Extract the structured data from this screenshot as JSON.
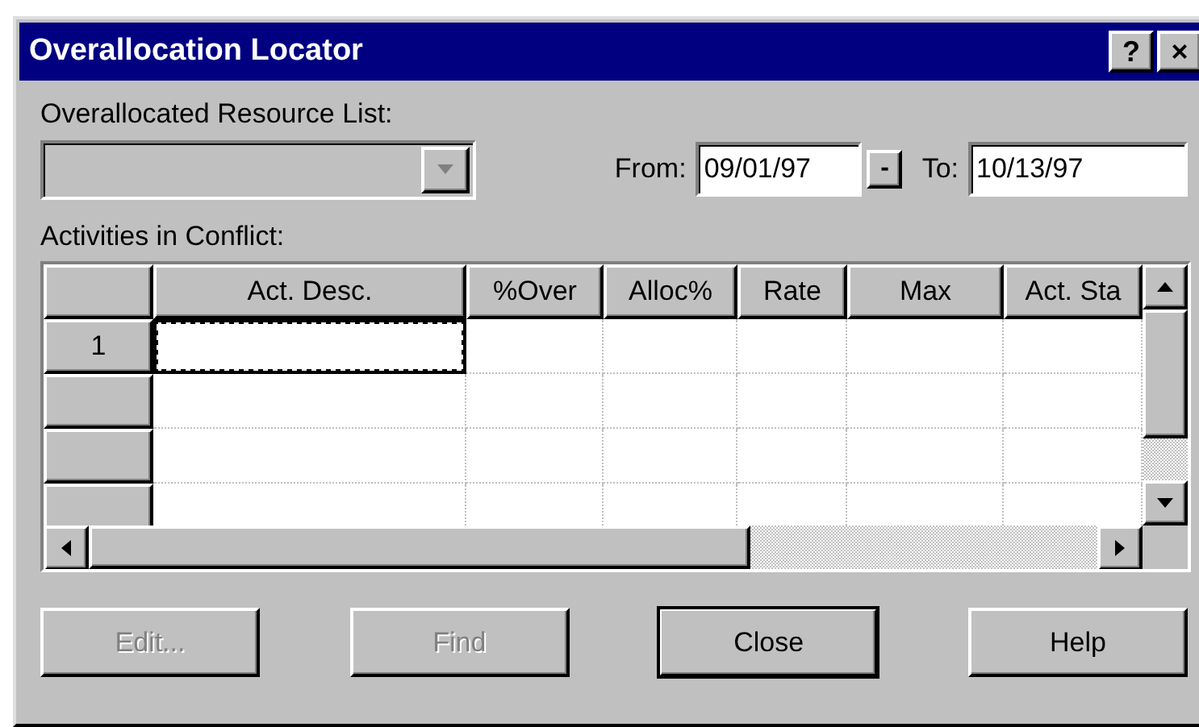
{
  "window": {
    "title": "Overallocation Locator",
    "title_buttons": [
      "?",
      "×"
    ]
  },
  "resource_list": {
    "label": "Overallocated Resource List:",
    "disabled": true
  },
  "date_range": {
    "from_label": "From:",
    "from_value": "09/01/97",
    "spin": "-",
    "to_label": "To:",
    "to_value": "10/13/97"
  },
  "grid": {
    "label": "Activities in Conflict:",
    "columns": [
      "Act. Desc.",
      "%Over",
      "Alloc%",
      "Rate",
      "Max",
      "Act. Sta"
    ],
    "rows": [
      {
        "number": "1",
        "selected": true
      },
      {
        "selected": false
      },
      {
        "selected": false
      },
      {
        "selected": false
      }
    ]
  },
  "buttons": [
    {
      "label": "Edit...",
      "disabled": true,
      "default": false
    },
    {
      "label": "Find",
      "disabled": true,
      "default": false
    },
    {
      "label": "Close",
      "disabled": false,
      "default": true
    },
    {
      "label": "Help",
      "disabled": false,
      "default": false
    }
  ]
}
